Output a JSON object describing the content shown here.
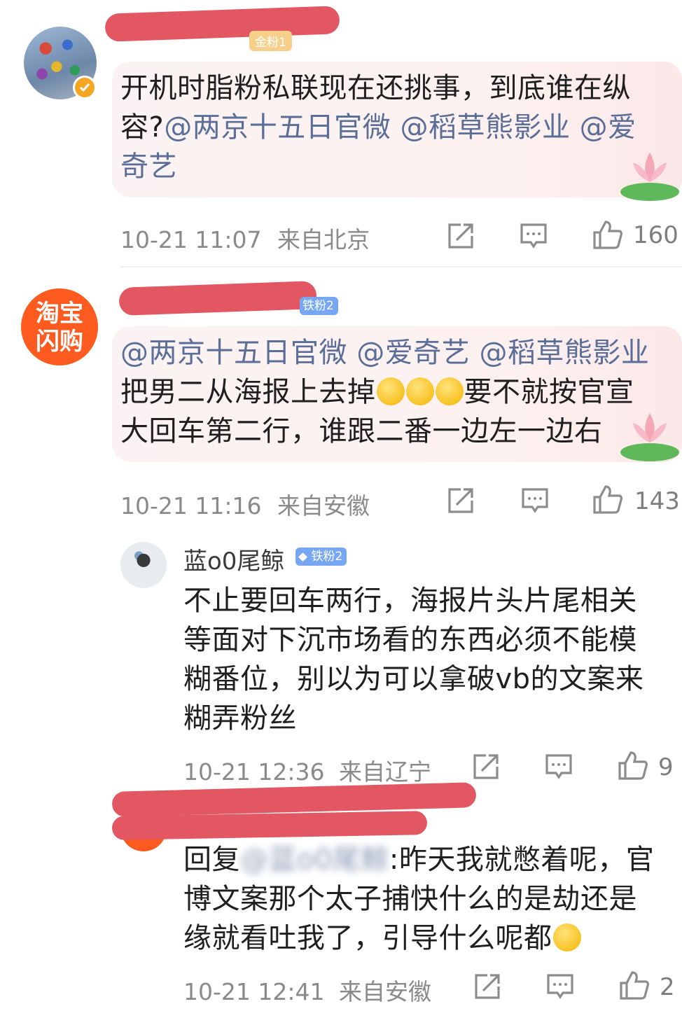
{
  "comments": [
    {
      "badge": "金粉1",
      "text": "开机时脂粉私联现在还挑事，到底谁在纵容?",
      "mentions": [
        "@两京十五日官微",
        "@稻草熊影业",
        "@爱奇艺"
      ],
      "time": "10-21 11:07",
      "location": "来自北京",
      "likes": "160"
    },
    {
      "avatar_text": [
        "淘宝",
        "闪购"
      ],
      "badge": "铁粉2",
      "mentions": [
        "@两京十五日官微",
        "@爱奇艺",
        "@稻草熊影业"
      ],
      "text_part1": "把男二从海报上去掉",
      "text_part2": "要不就按官宣大回车第二行，谁跟二番一边左一边右",
      "time": "10-21 11:16",
      "location": "来自安徽",
      "likes": "143"
    }
  ],
  "replies": [
    {
      "username": "蓝o0尾鲸",
      "badge": "铁粉2",
      "text": "不止要回车两行，海报片头片尾相关等面对下沉市场看的东西必须不能模糊番位，别以为可以拿破vb的文案来糊弄粉丝",
      "time": "10-21 12:36",
      "location": "来自辽宁",
      "likes": "9"
    },
    {
      "prefix": "回复",
      "blurred_name": "@蓝o0尾鲸",
      "text": ":昨天我就憋着呢，官博文案那个太子捕快什么的是劫还是缘就看吐我了，引导什么呢都",
      "time": "10-21 12:41",
      "location": "来自安徽",
      "likes": "2"
    }
  ],
  "icons": [
    "share-icon",
    "comment-icon",
    "like-icon",
    "verified-icon",
    "lotus-decoration-icon",
    "facepalm-emoji-icon",
    "thinking-emoji-icon"
  ],
  "colors": {
    "mention": "#5a6e98",
    "redaction": "#e35763",
    "badge": "#77a6f3",
    "meta": "#8a8a8a"
  }
}
